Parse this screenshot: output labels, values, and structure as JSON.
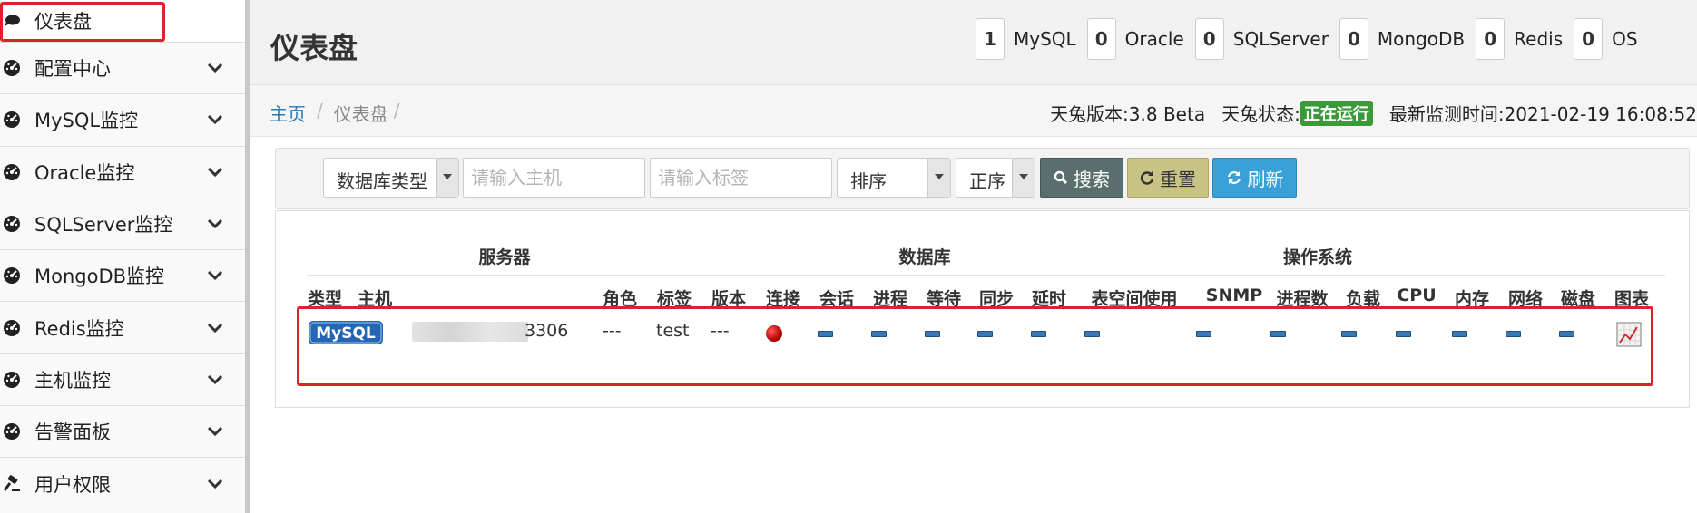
{
  "sidebar": {
    "items": [
      {
        "label": "仪表盘",
        "icon": "comment-icon",
        "active": true
      },
      {
        "label": "配置中心",
        "icon": "dashboard-gauge-icon"
      },
      {
        "label": "MySQL监控",
        "icon": "dashboard-gauge-icon"
      },
      {
        "label": "Oracle监控",
        "icon": "dashboard-gauge-icon"
      },
      {
        "label": "SQLServer监控",
        "icon": "dashboard-gauge-icon"
      },
      {
        "label": "MongoDB监控",
        "icon": "dashboard-gauge-icon"
      },
      {
        "label": "Redis监控",
        "icon": "dashboard-gauge-icon"
      },
      {
        "label": "主机监控",
        "icon": "dashboard-gauge-icon"
      },
      {
        "label": "告警面板",
        "icon": "dashboard-gauge-icon"
      },
      {
        "label": "用户权限",
        "icon": "gavel-icon"
      }
    ]
  },
  "header": {
    "title": "仪表盘",
    "counters": [
      {
        "count": "1",
        "name": "MySQL"
      },
      {
        "count": "0",
        "name": "Oracle"
      },
      {
        "count": "0",
        "name": "SQLServer"
      },
      {
        "count": "0",
        "name": "MongoDB"
      },
      {
        "count": "0",
        "name": "Redis"
      },
      {
        "count": "0",
        "name": "OS"
      }
    ]
  },
  "breadcrumb": {
    "home": "主页",
    "separator": "/",
    "current": "仪表盘"
  },
  "status": {
    "version_label": "天兔版本:3.8 Beta",
    "state_label": "天兔状态:",
    "state_badge": "正在运行",
    "last_check": "最新监测时间:2021-02-19 16:08:52"
  },
  "search": {
    "db_type": "数据库类型",
    "host_placeholder": "请输入主机",
    "tag_placeholder": "请输入标签",
    "sort": "排序",
    "order": "正序",
    "search_label": "搜索",
    "reset_label": "重置",
    "refresh_label": "刷新"
  },
  "table": {
    "groups": {
      "server": "服务器",
      "database": "数据库",
      "os": "操作系统"
    },
    "columns": [
      "类型",
      "主机",
      "角色",
      "标签",
      "版本",
      "连接",
      "会话",
      "进程",
      "等待",
      "同步",
      "延时",
      "表空间使用",
      "SNMP",
      "进程数",
      "负载",
      "CPU",
      "内存",
      "网络",
      "磁盘",
      "图表"
    ],
    "row": {
      "type": "MySQL",
      "host_suffix": "3306",
      "role": "---",
      "tag": "test",
      "version": "---"
    }
  },
  "colors": {
    "accent_link": "#2a7ab7",
    "running_badge": "#3a9a3a",
    "search_button": "#5a6e6e",
    "reset_button": "#c9c486",
    "refresh_button": "#3aa0d8",
    "highlight": "#e0202b"
  }
}
